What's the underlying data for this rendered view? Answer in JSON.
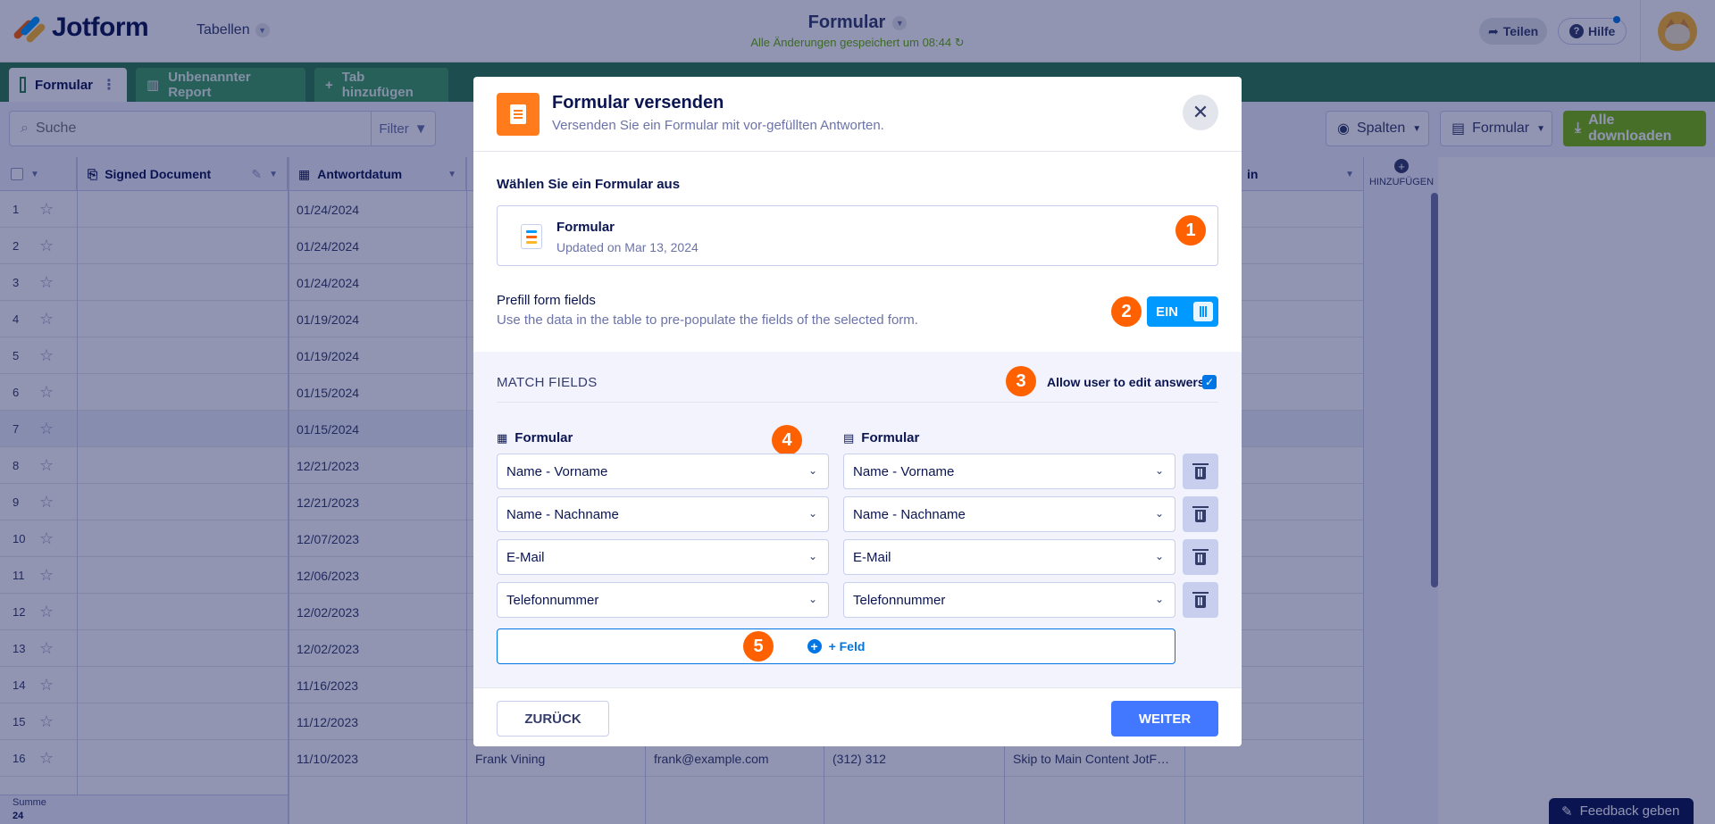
{
  "header": {
    "brand": "Jotform",
    "section": "Tabellen",
    "doc_title": "Formular",
    "saved_status": "Alle Änderungen gespeichert um 08:44",
    "share_label": "Teilen",
    "help_label": "Hilfe"
  },
  "tabs": [
    {
      "label": "Formular"
    },
    {
      "label": "Unbenannter Report"
    },
    {
      "label": "Tab hinzufügen"
    }
  ],
  "toolbar": {
    "search_placeholder": "Suche",
    "filter_label": "Filter",
    "columns_label": "Spalten",
    "form_label": "Formular",
    "download_label": "Alle downloaden"
  },
  "table": {
    "columns": [
      "Signed Document",
      "Antwortdatum"
    ],
    "add_column_label": "HINZUFÜGEN",
    "rows": [
      {
        "n": "1",
        "date": "01/24/2024"
      },
      {
        "n": "2",
        "date": "01/24/2024"
      },
      {
        "n": "3",
        "date": "01/24/2024"
      },
      {
        "n": "4",
        "date": "01/19/2024"
      },
      {
        "n": "5",
        "date": "01/19/2024"
      },
      {
        "n": "6",
        "date": "01/15/2024"
      },
      {
        "n": "7",
        "date": "01/15/2024"
      },
      {
        "n": "8",
        "date": "12/21/2023"
      },
      {
        "n": "9",
        "date": "12/21/2023"
      },
      {
        "n": "10",
        "date": "12/07/2023"
      },
      {
        "n": "11",
        "date": "12/06/2023"
      },
      {
        "n": "12",
        "date": "12/02/2023"
      },
      {
        "n": "13",
        "date": "12/02/2023"
      },
      {
        "n": "14",
        "date": "11/16/2023"
      },
      {
        "n": "15",
        "date": "11/12/2023"
      },
      {
        "n": "16",
        "date": "11/10/2023",
        "name": "Frank Vining",
        "email": "frank@example.com",
        "phone": "(312) 312",
        "page": "Skip to Main Content JotF…"
      }
    ],
    "partial_header": "in",
    "sum_label": "Summe",
    "sum_value": "24"
  },
  "feedback_label": "Feedback geben",
  "modal": {
    "title": "Formular versenden",
    "subtitle": "Versenden Sie ein Formular mit vor-gefüllten Antworten.",
    "choose_label": "Wählen Sie ein Formular aus",
    "form_name": "Formular",
    "form_updated": "Updated on Mar 13, 2024",
    "prefill_title": "Prefill form fields",
    "prefill_desc": "Use the data in the table to pre-populate the fields of the selected form.",
    "toggle_label": "EIN",
    "match_title": "MATCH FIELDS",
    "allow_edit_label": "Allow user to edit answers",
    "left_col_title": "Formular",
    "right_col_title": "Formular",
    "mappings": [
      {
        "left": "Name - Vorname",
        "right": "Name - Vorname"
      },
      {
        "left": "Name - Nachname",
        "right": "Name - Nachname"
      },
      {
        "left": "E-Mail",
        "right": "E-Mail"
      },
      {
        "left": "Telefonnummer",
        "right": "Telefonnummer"
      }
    ],
    "add_field_label": "+ Feld",
    "back_label": "ZURÜCK",
    "next_label": "WEITER",
    "step_badges": [
      "1",
      "2",
      "3",
      "4",
      "5"
    ]
  },
  "colors": {
    "brand_green": "#2e7d4f",
    "accent_orange": "#ff6100",
    "primary_blue": "#4277ff",
    "toggle_blue": "#0099ff",
    "download_green": "#78bb07"
  }
}
